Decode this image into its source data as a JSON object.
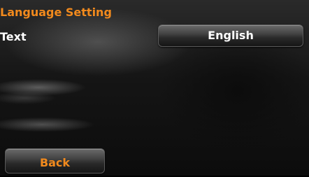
{
  "screen": {
    "title": "Language Setting"
  },
  "settings": {
    "text_label": "Text",
    "text_value": "English"
  },
  "footer": {
    "back_label": "Back"
  },
  "colors": {
    "accent": "#f28a1d",
    "label": "#ffffff",
    "background": "#000000"
  }
}
